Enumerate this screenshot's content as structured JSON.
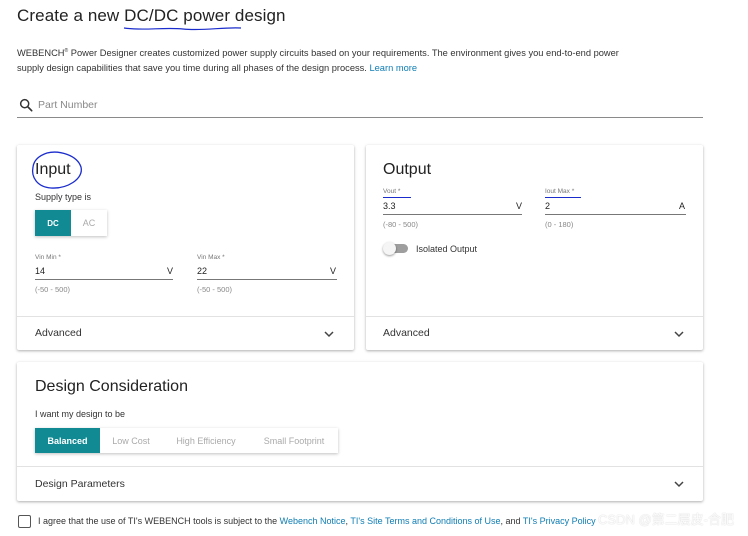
{
  "header": {
    "title": "Create a new DC/DC power design",
    "desc_brand": "WEBENCH",
    "desc_sup": "®",
    "desc_text": " Power Designer creates customized power supply circuits based on your requirements. The environment gives you end-to-end power supply design capabilities that save you time during all phases of the design process. ",
    "learn_more": "Learn more"
  },
  "search": {
    "icon": "search-icon",
    "placeholder": "Part Number"
  },
  "input_card": {
    "title": "Input",
    "supply_label": "Supply type is",
    "dc_label": "DC",
    "ac_label": "AC",
    "vin_min": {
      "label": "Vin Min *",
      "value": "14",
      "unit": "V",
      "range": "(-50 - 500)"
    },
    "vin_max": {
      "label": "Vin Max *",
      "value": "22",
      "unit": "V",
      "range": "(-50 - 500)"
    },
    "advanced": "Advanced"
  },
  "output_card": {
    "title": "Output",
    "vout": {
      "label": "Vout *",
      "value": "3.3",
      "unit": "V",
      "range": "(-80 - 500)"
    },
    "iout": {
      "label": "Iout Max *",
      "value": "2",
      "unit": "A",
      "range": "(0 - 180)"
    },
    "isolated_label": "Isolated Output",
    "isolated_on": false,
    "advanced": "Advanced"
  },
  "design_card": {
    "title": "Design Consideration",
    "want_label": "I want my design to be",
    "options": [
      "Balanced",
      "Low Cost",
      "High Efficiency",
      "Small Footprint"
    ],
    "selected": "Balanced",
    "params": "Design Parameters"
  },
  "agreement": {
    "text_before": "I agree that the use of TI's WEBENCH tools is subject to the ",
    "link1": "Webench Notice",
    "sep1": ", ",
    "link2": "TI's Site Terms and Conditions of Use",
    "sep2": ", and ",
    "link3": "TI's Privacy Policy"
  },
  "watermark": "CSDN @第二层皮-合肥",
  "colors": {
    "accent": "#118a94",
    "link": "#0f7db4",
    "ink": "#1a2ccc"
  }
}
